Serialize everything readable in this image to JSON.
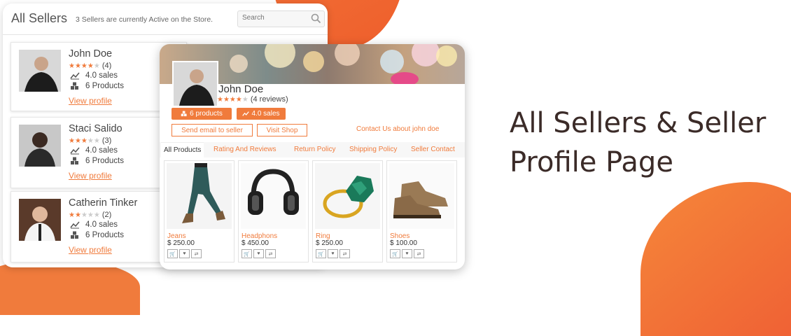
{
  "colors": {
    "accent": "#f07b3c",
    "heading": "#3b2b28"
  },
  "headline": "All Sellers & Seller Profile Page",
  "all_sellers": {
    "title": "All Sellers",
    "subtitle": "3 Sellers are currently Active on the Store.",
    "search_placeholder": "Search",
    "sellers": [
      {
        "name": "John Doe",
        "rating": 4,
        "rating_count": "(4)",
        "sales": "4.0 sales",
        "products": "6 Products",
        "link": "View profile"
      },
      {
        "name": "Staci Salido",
        "rating": 3,
        "rating_count": "(3)",
        "sales": "4.0 sales",
        "products": "6 Products",
        "link": "View profile"
      },
      {
        "name": "Catherin Tinker",
        "rating": 2,
        "rating_count": "(2)",
        "sales": "4.0 sales",
        "products": "6 Products",
        "link": "View profile"
      }
    ]
  },
  "profile": {
    "name": "John Doe",
    "rating": 4,
    "reviews": "(4 reviews)",
    "badge_products": "6 products",
    "badge_sales": "4.0 sales",
    "send_email": "Send email to seller",
    "visit_shop": "Visit Shop",
    "contact": "Contact Us about john doe",
    "tabs": [
      "All Products",
      "Rating And Reviews",
      "Return Policy",
      "Shipping Policy",
      "Seller Contact"
    ],
    "products": [
      {
        "name": "Jeans",
        "price": "$ 250.00"
      },
      {
        "name": "Headphons",
        "price": "$ 450.00"
      },
      {
        "name": "Ring",
        "price": "$ 250.00"
      },
      {
        "name": "Shoes",
        "price": "$ 100.00"
      }
    ]
  }
}
